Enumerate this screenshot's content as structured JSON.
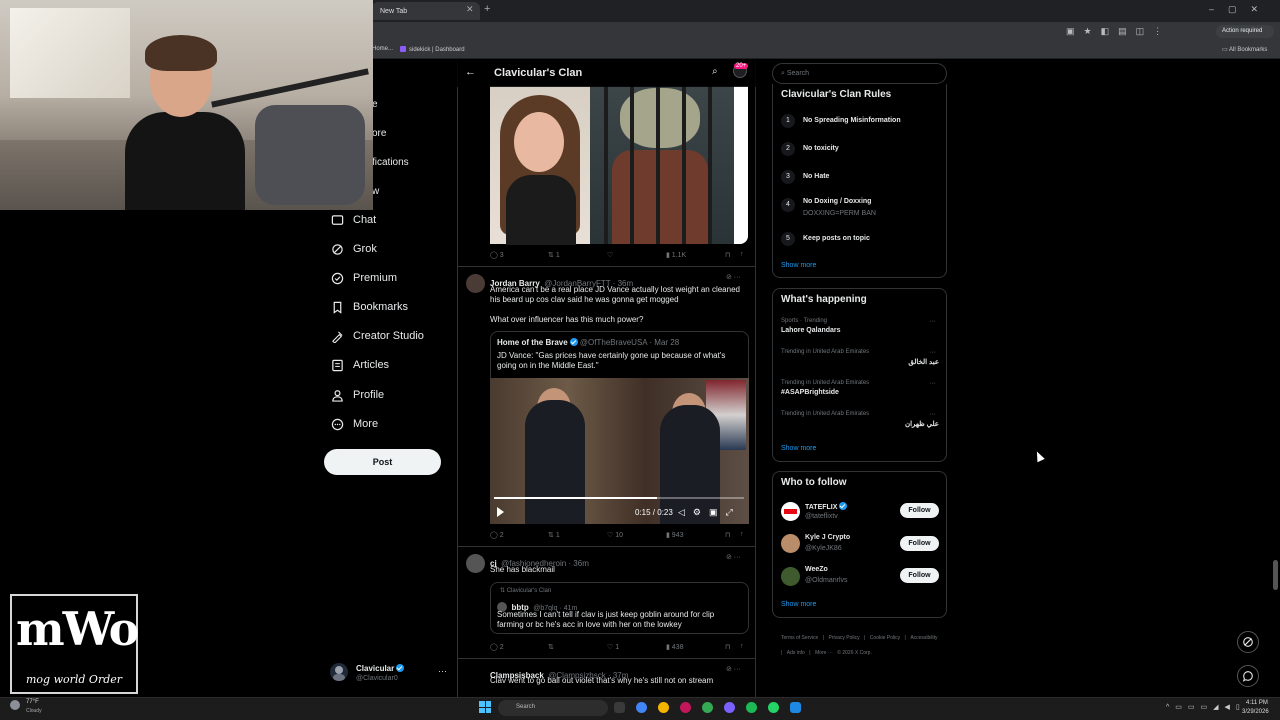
{
  "browser": {
    "tab_title": "New Tab",
    "bookmarks": [
      "Home...",
      "sidekick | Dashboard"
    ],
    "all_bookmarks": "All Bookmarks",
    "action_required": "Action required"
  },
  "nav": {
    "partials": [
      "e",
      "ore",
      "fications",
      "w"
    ],
    "items": [
      {
        "label": "Chat",
        "icon": "chat-icon"
      },
      {
        "label": "Grok",
        "icon": "grok-icon"
      },
      {
        "label": "Premium",
        "icon": "premium-icon"
      },
      {
        "label": "Bookmarks",
        "icon": "bookmark-icon"
      },
      {
        "label": "Creator Studio",
        "icon": "creator-studio-icon"
      },
      {
        "label": "Articles",
        "icon": "articles-icon"
      },
      {
        "label": "Profile",
        "icon": "profile-icon"
      },
      {
        "label": "More",
        "icon": "more-icon"
      }
    ],
    "post_label": "Post",
    "account": {
      "name": "Clavicular",
      "handle": "@Clavicular0"
    }
  },
  "overlay": {
    "logo_big": "mWo",
    "logo_sub": "mog world Order"
  },
  "community": {
    "title": "Clavicular's Clan",
    "badge": "20+"
  },
  "posts": [
    {
      "actions": {
        "replies": "3",
        "reposts": "1",
        "likes": "",
        "views": "1.1K"
      }
    },
    {
      "name": "Jordan Barry",
      "handle": "@JordanBarryFTT · 36m",
      "text": "America can't be a real place JD Vance actually lost weight an cleaned his beard up cos clav said he was gonna get mogged",
      "text2": "What over influencer has this much power?",
      "quote": {
        "name": "Home of the Brave",
        "handle": "@OfTheBraveUSA · Mar 28",
        "text": "JD Vance: \"Gas prices have certainly gone up because of what's going on in the Middle East.\""
      },
      "video": {
        "time": "0:15 / 0:23",
        "progress": 0.65
      },
      "actions": {
        "replies": "2",
        "reposts": "1",
        "likes": "10",
        "views": "943"
      }
    },
    {
      "name": "cj",
      "handle": "@fashionedheroin · 36m",
      "text": "She has blackmail",
      "quote": {
        "context": "Clavicular's Clan",
        "name": "bbtp",
        "handle": "@b7qlq · 41m",
        "text": "Sometimes I can't tell if clav is just keep goblin around for clip farming or bc he's acc in love with her on the lowkey"
      },
      "actions": {
        "replies": "2",
        "reposts": "",
        "likes": "1",
        "views": "438"
      }
    },
    {
      "name": "Clampsisback",
      "handle": "@Clampsizbsck · 37m",
      "text": "Clav went to go ball out violet that's why he's still not on stream"
    }
  ],
  "sidebar": {
    "search_placeholder": "Search",
    "rules_title": "Clavicular's Clan Rules",
    "rules": [
      {
        "num": "1",
        "text": "No Spreading Misinformation",
        "sub": ""
      },
      {
        "num": "2",
        "text": "No toxicity",
        "sub": ""
      },
      {
        "num": "3",
        "text": "No Hate",
        "sub": ""
      },
      {
        "num": "4",
        "text": "No Doxing / Doxxing",
        "sub": "DOXXING=PERM BAN"
      },
      {
        "num": "5",
        "text": "Keep posts on topic",
        "sub": ""
      }
    ],
    "show_more": "Show more",
    "happening_title": "What's happening",
    "trends": [
      {
        "context": "Sports · Trending",
        "name": "Lahore Qalandars",
        "rtl": false
      },
      {
        "context": "Trending in United Arab Emirates",
        "name": "عبد الخالق",
        "rtl": true
      },
      {
        "context": "Trending in United Arab Emirates",
        "name": "#ASAPBrightside",
        "rtl": false
      },
      {
        "context": "Trending in United Arab Emirates",
        "name": "علي ظهران",
        "rtl": true
      }
    ],
    "follow_title": "Who to follow",
    "follows": [
      {
        "name": "TATEFLIX",
        "handle": "@tateflixtv",
        "verified": true
      },
      {
        "name": "Kyle J Crypto",
        "handle": "@KyleJK86",
        "verified": false
      },
      {
        "name": "WeeZo",
        "handle": "@Oldmanrlvs",
        "verified": false
      }
    ],
    "follow_label": "Follow",
    "footer": [
      "Terms of Service",
      "|",
      "Privacy Policy",
      "|",
      "Cookie Policy",
      "|",
      "Accessibility",
      "|",
      "Ads info",
      "|",
      "More ···",
      "© 2026 X Corp."
    ]
  },
  "taskbar": {
    "weather_temp": "77°F",
    "weather_desc": "Cloudy",
    "search_label": "Search",
    "time": "4:11 PM",
    "date": "3/29/2026"
  }
}
